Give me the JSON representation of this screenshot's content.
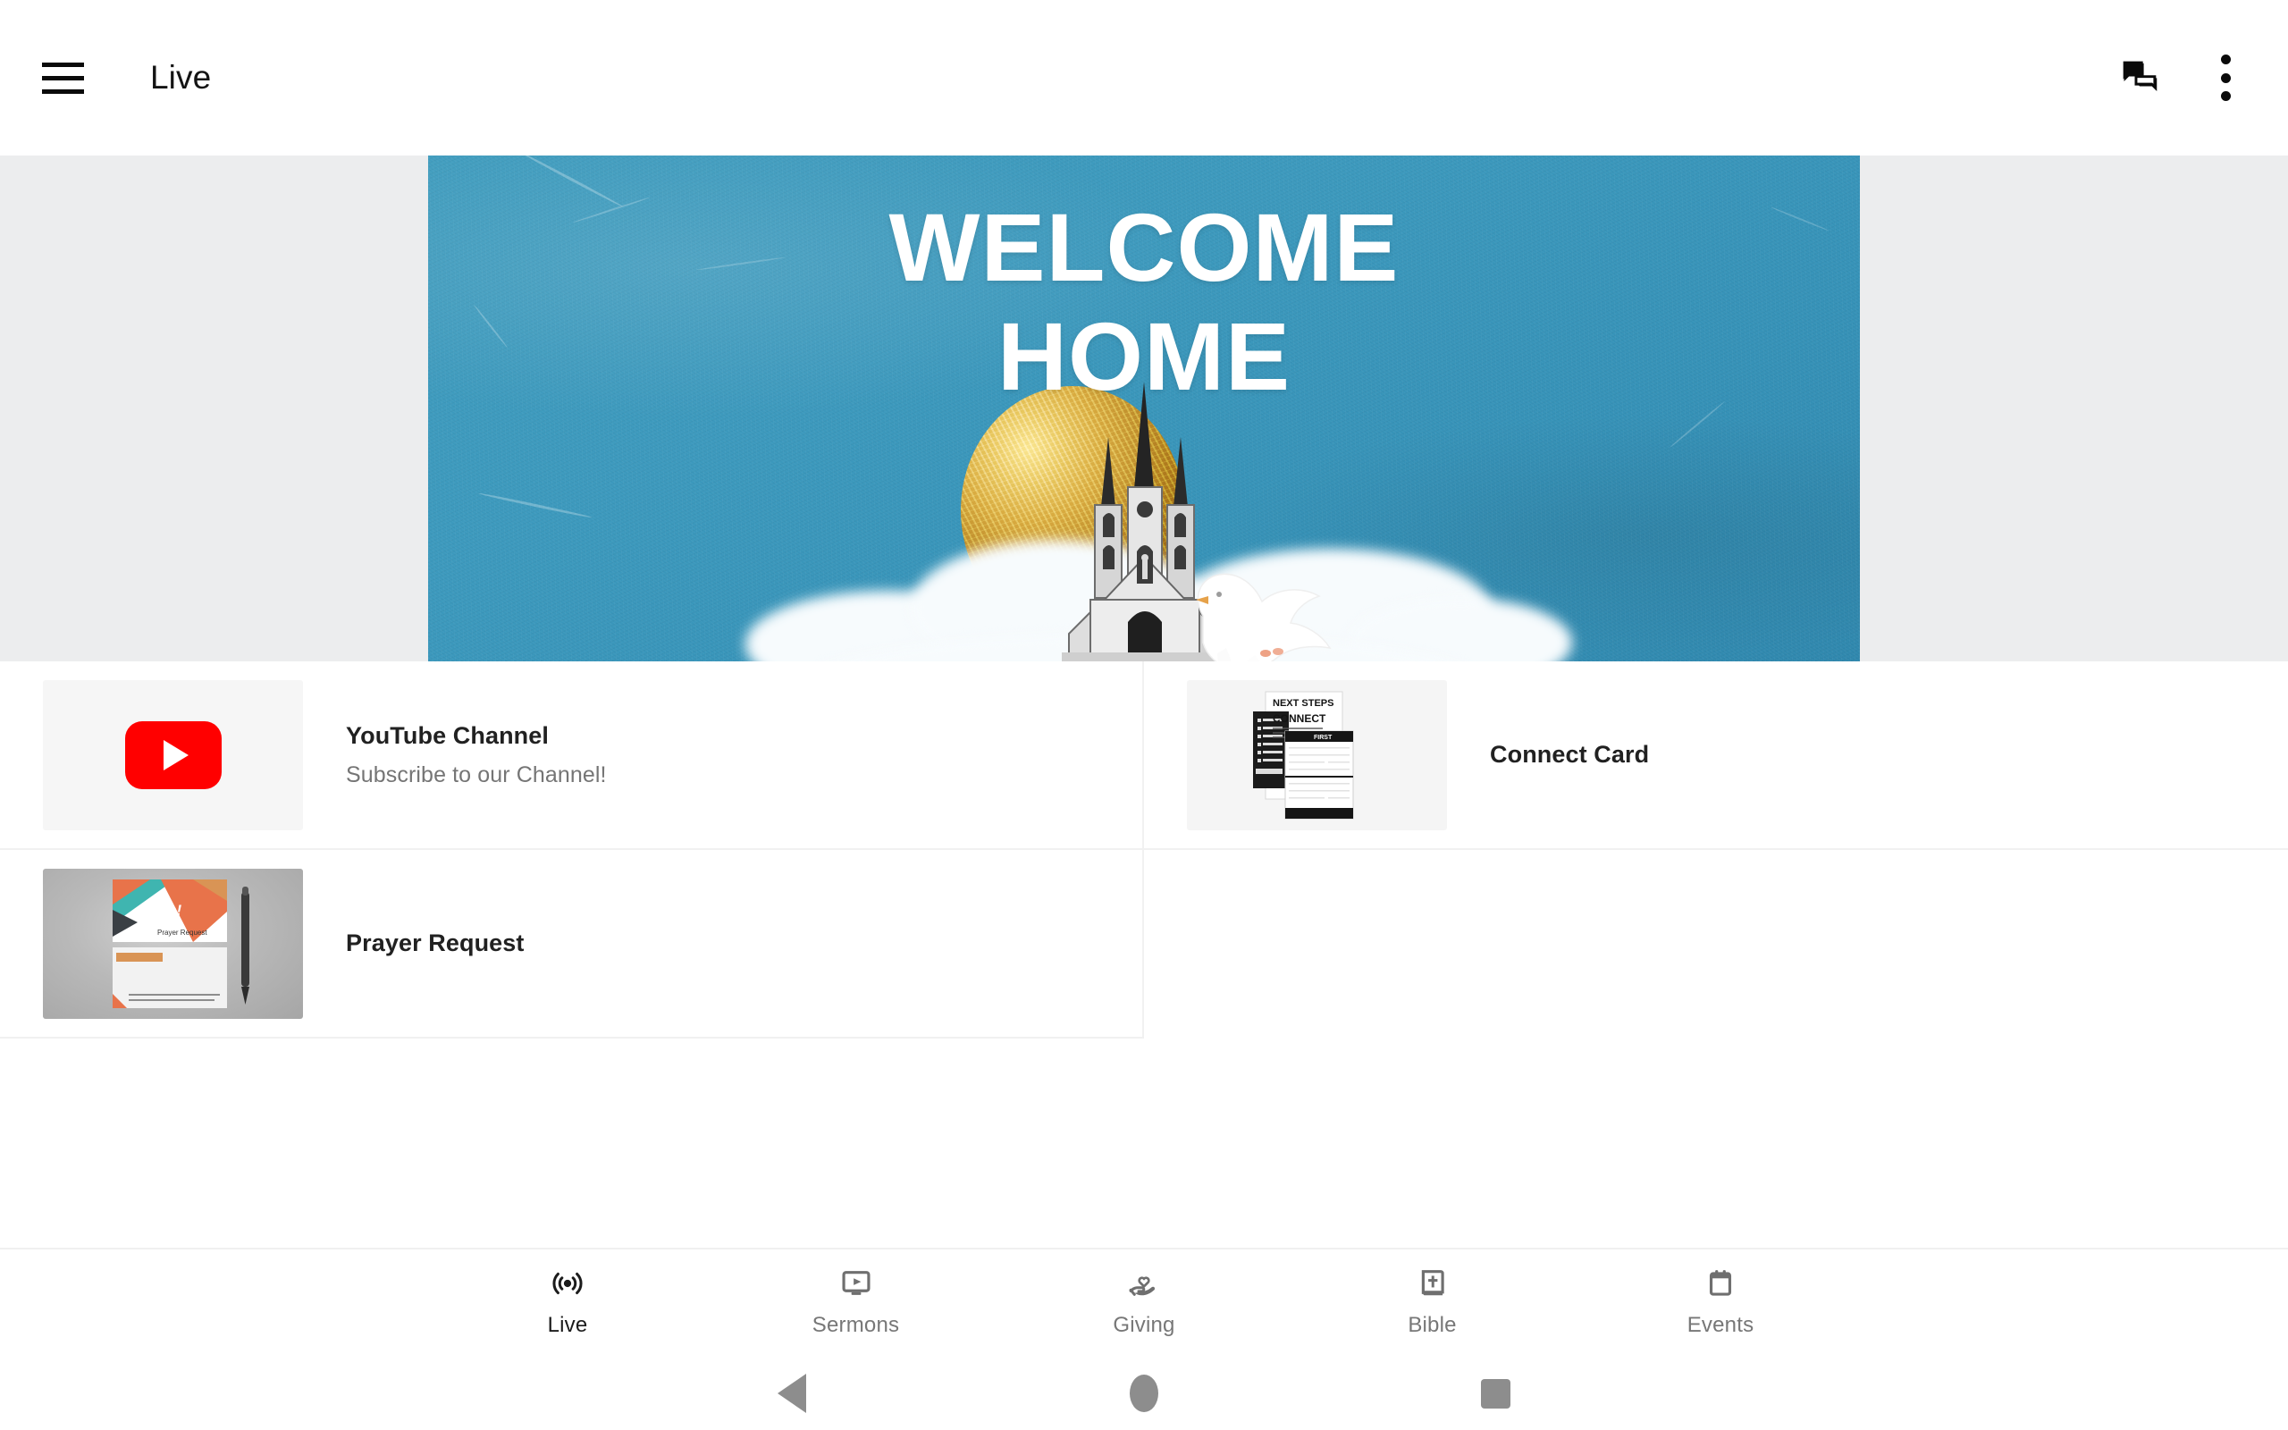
{
  "app": {
    "title": "Live"
  },
  "topbar": {
    "menu_icon": "hamburger-menu-icon",
    "chat_icon": "chat-bubbles-icon",
    "overflow_icon": "more-vertical-icon"
  },
  "hero": {
    "headline": "WELCOME\nHOME",
    "background_color": "#3c99bd",
    "accent_gold": "#d9b75a",
    "surround_color": "#ECEDEE",
    "art": [
      "golden-circle",
      "church-building",
      "white-dove",
      "clouds"
    ]
  },
  "cards": [
    {
      "title": "YouTube Channel",
      "subtitle": "Subscribe to our Channel!",
      "thumb": "youtube-logo-thumbnail",
      "thumb_color": "#ff0000"
    },
    {
      "title": "Connect Card",
      "subtitle": "",
      "thumb": "connect-card-thumbnail",
      "thumb_text_top": "NEXT STEPS",
      "thumb_text_bottom": "CONNECT"
    },
    {
      "title": "Prayer Request",
      "subtitle": "",
      "thumb": "prayer-request-thumbnail",
      "thumb_card_label": "All In!",
      "thumb_card_sub": "Prayer Request"
    }
  ],
  "bottom_nav": {
    "items": [
      {
        "label": "Live",
        "icon": "broadcast-icon",
        "active": true
      },
      {
        "label": "Sermons",
        "icon": "video-player-icon",
        "active": false
      },
      {
        "label": "Giving",
        "icon": "hand-heart-icon",
        "active": false
      },
      {
        "label": "Bible",
        "icon": "book-cross-icon",
        "active": false
      },
      {
        "label": "Events",
        "icon": "calendar-icon",
        "active": false
      }
    ],
    "active_color": "#1b1b1b",
    "inactive_color": "#777777"
  },
  "system_nav": {
    "back": "back-triangle-icon",
    "home": "home-circle-icon",
    "recents": "recents-square-icon",
    "color": "#8d8d8d"
  }
}
